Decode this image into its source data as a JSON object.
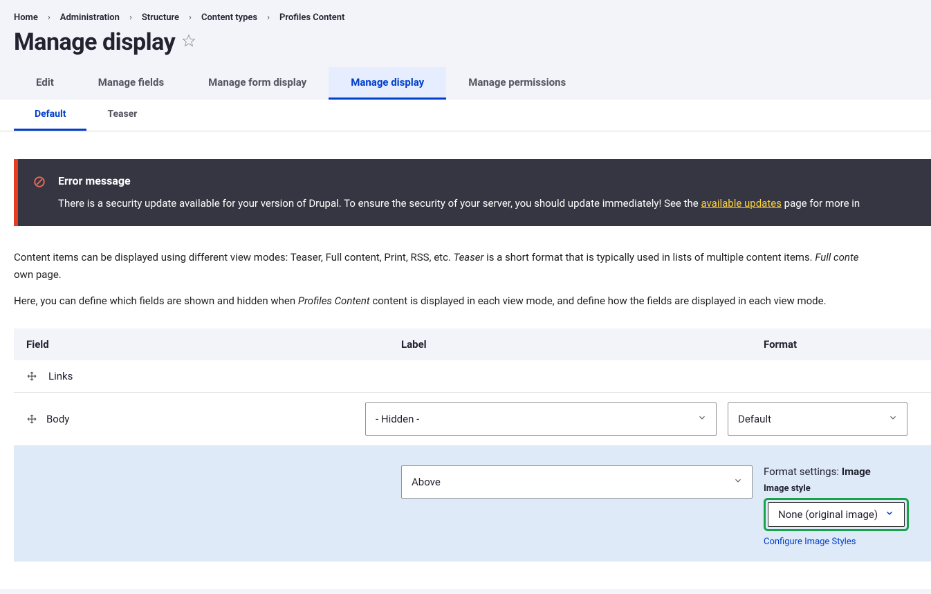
{
  "breadcrumb": [
    {
      "label": "Home"
    },
    {
      "label": "Administration"
    },
    {
      "label": "Structure"
    },
    {
      "label": "Content types"
    },
    {
      "label": "Profiles Content"
    }
  ],
  "page_title": "Manage display",
  "primary_tabs": [
    {
      "label": "Edit",
      "active": false
    },
    {
      "label": "Manage fields",
      "active": false
    },
    {
      "label": "Manage form display",
      "active": false
    },
    {
      "label": "Manage display",
      "active": true
    },
    {
      "label": "Manage permissions",
      "active": false
    }
  ],
  "secondary_tabs": [
    {
      "label": "Default",
      "active": true
    },
    {
      "label": "Teaser",
      "active": false
    }
  ],
  "error": {
    "title": "Error message",
    "text_before": "There is a security update available for your version of Drupal. To ensure the security of your server, you should update immediately! See the ",
    "link": "available updates",
    "text_after": " page for more in"
  },
  "desc": {
    "p1a": "Content items can be displayed using different view modes: Teaser, Full content, Print, RSS, etc. ",
    "p1em1": "Teaser",
    "p1b": " is a short format that is typically used in lists of multiple content items. ",
    "p1em2": "Full conte",
    "p1c": "own page.",
    "p2a": "Here, you can define which fields are shown and hidden when ",
    "p2em": "Profiles Content",
    "p2b": " content is displayed in each view mode, and define how the fields are displayed in each view mode."
  },
  "table": {
    "headers": {
      "field": "Field",
      "label": "Label",
      "format": "Format"
    },
    "rows": {
      "links": {
        "name": "Links"
      },
      "body": {
        "name": "Body",
        "label_sel": "- Hidden -",
        "format_sel": "Default"
      },
      "image": {
        "label_sel": "Above",
        "fs_title_prefix": "Format settings: ",
        "fs_title_bold": "Image",
        "fs_label": "Image style",
        "style_value": "None (original image)",
        "cfg_link": "Configure Image Styles"
      }
    }
  }
}
